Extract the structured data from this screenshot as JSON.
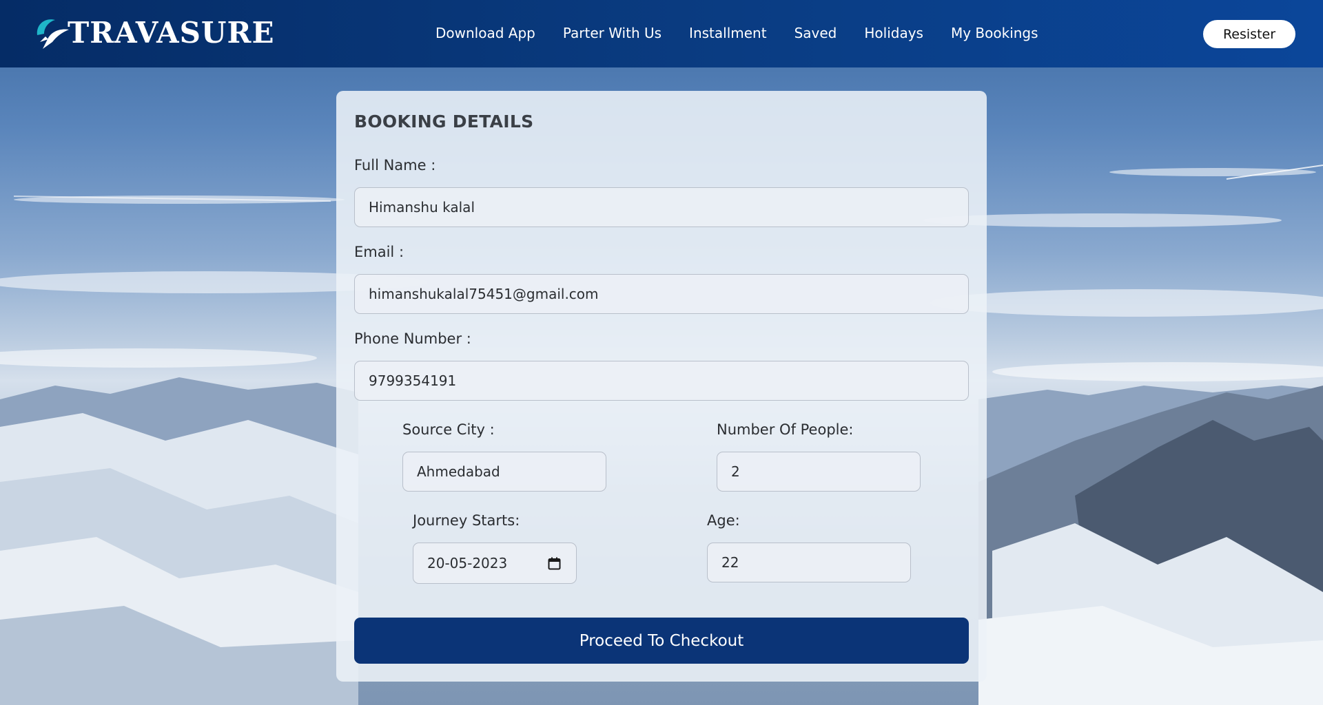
{
  "brand": {
    "name": "TRAVASURE",
    "accent": "#1fb6c9"
  },
  "nav": {
    "items": [
      {
        "label": "Download App"
      },
      {
        "label": "Parter With Us"
      },
      {
        "label": "Installment"
      },
      {
        "label": "Saved"
      },
      {
        "label": "Holidays"
      },
      {
        "label": "My Bookings"
      }
    ],
    "register_label": "Resister"
  },
  "form": {
    "title": "BOOKING DETAILS",
    "full_name": {
      "label": "Full Name :",
      "value": "Himanshu kalal"
    },
    "email": {
      "label": "Email :",
      "value": "himanshukalal75451@gmail.com"
    },
    "phone": {
      "label": "Phone Number :",
      "value": "9799354191"
    },
    "source_city": {
      "label": "Source City :",
      "value": "Ahmedabad"
    },
    "num_people": {
      "label": "Number Of People:",
      "value": "2"
    },
    "journey_start": {
      "label": "Journey Starts:",
      "value": "20-05-2023"
    },
    "age": {
      "label": "Age:",
      "value": "22"
    },
    "submit_label": "Proceed To Checkout"
  },
  "colors": {
    "header": "#0a3c82",
    "primary_button": "#0b3477"
  }
}
